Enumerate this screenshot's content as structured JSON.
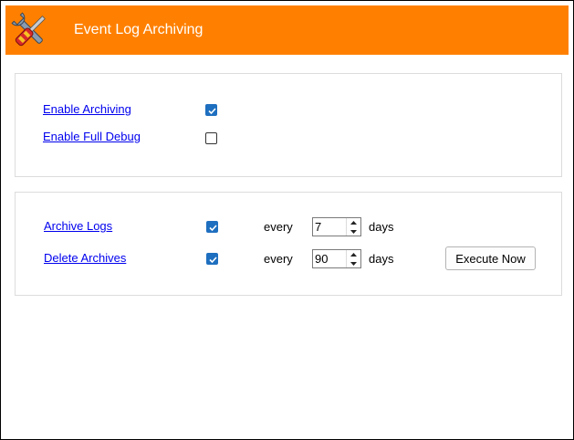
{
  "header": {
    "title": "Event Log Archiving",
    "icon": "tools-icon",
    "background_color": "#ff8000"
  },
  "settings": {
    "enable_archiving": {
      "label": "Enable Archiving",
      "checked": true
    },
    "enable_full_debug": {
      "label": "Enable Full Debug",
      "checked": false
    }
  },
  "schedule": {
    "archive_logs": {
      "label": "Archive Logs",
      "checked": true,
      "every_label": "every",
      "value": "7",
      "unit_label": "days"
    },
    "delete_archives": {
      "label": "Delete Archives",
      "checked": true,
      "every_label": "every",
      "value": "90",
      "unit_label": "days"
    },
    "execute_label": "Execute Now"
  },
  "colors": {
    "accent": "#ff8000",
    "checkbox_checked": "#1e6fbf",
    "link": "#0000ee"
  }
}
